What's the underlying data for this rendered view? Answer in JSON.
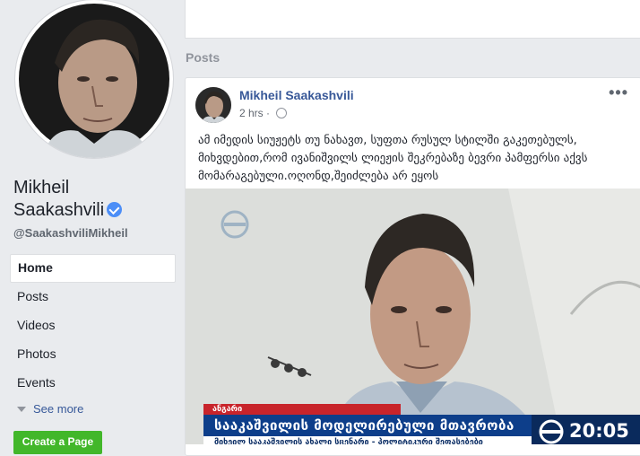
{
  "profile": {
    "name_line1": "Mikheil",
    "name_line2": "Saakashvili",
    "handle": "@SaakashviliMikheil"
  },
  "nav": {
    "items": [
      {
        "label": "Home"
      },
      {
        "label": "Posts"
      },
      {
        "label": "Videos"
      },
      {
        "label": "Photos"
      },
      {
        "label": "Events"
      }
    ],
    "see_more": "See more",
    "create_page": "Create a Page"
  },
  "posts_heading": "Posts",
  "post": {
    "author": "Mikheil Saakashvili",
    "time": "2 hrs",
    "more": "•••",
    "text": "ამ იმედის სიუჟეტს თუ ნახავთ, სუფთა რუსულ სტილში გაკეთებულს, მიხვდებით,რომ ივანიშვილს ლიეჟის შეკრებაზე ბევრი პამფერსი აქვს მომარაგებული.ოღონდ,შეიძლება არ ეყოს"
  },
  "video": {
    "tag": "ანგარი",
    "headline": "სააკაშვილის მოდელირებული მთავრობა",
    "subline": "მიხეილ სააკაშვილის ახალი სცენარი - პოლიტიკური შეფასებები",
    "clock": "20:05"
  },
  "colors": {
    "background": "#e9ebee",
    "link": "#385898",
    "verified": "#4c8ef7",
    "create_button": "#42b72a",
    "tv_blue": "#0d3e8a",
    "tv_red": "#c8242b"
  }
}
